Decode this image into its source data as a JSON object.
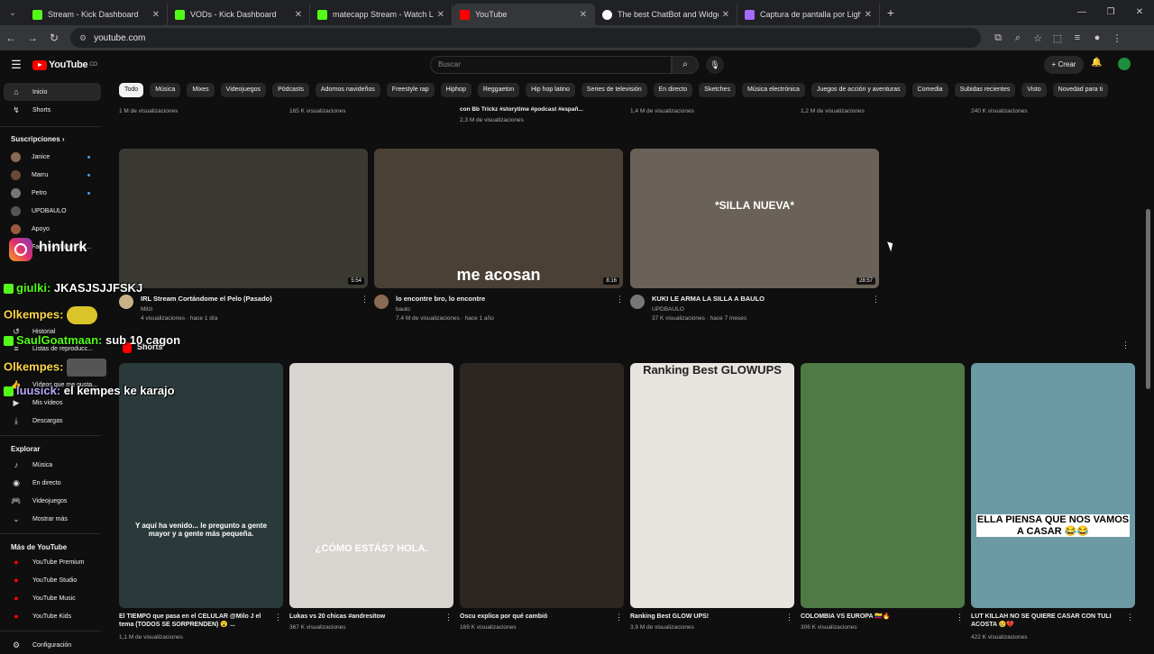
{
  "browser": {
    "tabs": [
      {
        "label": "Stream - Kick Dashboard",
        "color": "#53fc18"
      },
      {
        "label": "VODs - Kick Dashboard",
        "color": "#53fc18"
      },
      {
        "label": "matecapp Stream - Watch Live",
        "color": "#53fc18"
      },
      {
        "label": "YouTube",
        "color": "#ff0000"
      },
      {
        "label": "The best ChatBot and Widgets",
        "color": "#ffffff"
      },
      {
        "label": "Captura de pantalla por Lightshot",
        "color": "#a56bff"
      }
    ],
    "active_tab": 3,
    "url": "youtube.com"
  },
  "header": {
    "search_placeholder": "Buscar",
    "create_label": "Crear"
  },
  "chips": [
    "Todo",
    "Música",
    "Mixes",
    "Videojuegos",
    "Pódcasts",
    "Adornos navideños",
    "Freestyle rap",
    "Hiphop",
    "Reggaeton",
    "Hip hop latino",
    "Series de televisión",
    "En directo",
    "Sketches",
    "Música electrónica",
    "Juegos de acción y aventuras",
    "Comedia",
    "Subidas recientes",
    "Visto",
    "Novedad para ti"
  ],
  "sidebar": {
    "inicio": "Inicio",
    "shorts": "Shorts",
    "subs_title": "Suscripciones",
    "subs": [
      {
        "name": "Janice",
        "color": "#8a6a55"
      },
      {
        "name": "Marru",
        "color": "#6b4a3a"
      },
      {
        "name": "Petro",
        "color": "#777777"
      },
      {
        "name": "UPDBAULO",
        "color": "#555555"
      },
      {
        "name": "Apoyo",
        "color": "#995a3c"
      },
      {
        "name": "Fans Del JugueTon...",
        "color": "#444444"
      }
    ],
    "mostrar_mas_partial": "Mostrar más",
    "historial": "Historial",
    "listas": "Listas de reproducc...",
    "tus_videos": "Vídeos que me gusta...",
    "mis_videos": "Mis vídeos",
    "descargas": "Descargas",
    "explorar_title": "Explorar",
    "explorar": [
      "Música",
      "En directo",
      "Videojuegos",
      "Mostrar más"
    ],
    "mas_title": "Más de YouTube",
    "mas": [
      "YouTube Premium",
      "YouTube Studio",
      "YouTube Music",
      "YouTube Kids"
    ],
    "config": "Configuración"
  },
  "top_row": [
    "1 M de visualizaciones",
    "165 K visualizaciones",
    "con Bb Trickz #storytime #podcast #españ...",
    "2,3 M de visualizaciones",
    "1,4 M de visualizaciones",
    "1,2 M de visualizaciones",
    "240 K visualizaciones"
  ],
  "videos": [
    {
      "title": "IRL Stream Cortándome el Pelo (Pasado)",
      "channel": "Mitzi",
      "meta": "4 visualizaciones · hace 1 día",
      "duration": "5:54",
      "color": "#3b3a32",
      "avatar": "#c9b28a"
    },
    {
      "title": "lo encontre bro, lo encontre",
      "channel": "baulo",
      "meta": "7,4 M de visualizaciones · hace 1 año",
      "duration": "8:16",
      "color": "#4a4036",
      "avatar": "#8a6a55",
      "caption": "me acosan"
    },
    {
      "title": "KUKI LE ARMA LA SILLA A BAULO",
      "channel": "UPDBAULO",
      "meta": "37 K visualizaciones · hace 7 meses",
      "duration": "28:57",
      "color": "#6a6258",
      "avatar": "#777777",
      "caption": "*SILLA NUEVA*"
    }
  ],
  "shorts_title": "Shorts",
  "shorts": [
    {
      "title": "El TIEMPO que pasa en el CELULAR @Milo J el tema (TODOS SE SORPRENDEN) 😮 ...",
      "meta": "1,1 M de visualizaciones",
      "color": "#2a3a3a",
      "caption": "Y aquí ha venido... le pregunto a gente mayor y a gente más pequeña."
    },
    {
      "title": "Lukas vs 20 chicas #andresitow",
      "meta": "367 K visualizaciones",
      "color": "#d8d5d0",
      "caption": "¿CÓMO ESTÁS? HOLA."
    },
    {
      "title": "Oscu explica por qué cambió",
      "meta": "169 K visualizaciones",
      "color": "#2b2622",
      "caption": ""
    },
    {
      "title": "Ranking Best GLOW UPS!",
      "meta": "3,9 M de visualizaciones",
      "color": "#e7e4df",
      "caption": "Ranking Best GLOWUPS"
    },
    {
      "title": "COLOMBIA VS EUROPA 🇨🇴🔥",
      "meta": "306 K visualizaciones",
      "color": "#4f7a45",
      "caption": ""
    },
    {
      "title": "LUT KILLAH NO SE QUIERE CASAR CON TULI ACOSTA 😢💔",
      "meta": "422 K visualizaciones",
      "color": "#6b9aa5",
      "caption": "ELLA PIENSA QUE NOS VAMOS A CASAR 😂😂"
    }
  ],
  "overlay": {
    "ig_name": "hinlurk",
    "chat": [
      {
        "user": "giulki:",
        "msg": "JKASJSJJFSKJ"
      },
      {
        "user": "Olkempes:",
        "msg": ""
      },
      {
        "user": "SaulGoatmaan:",
        "msg": "sub 10 cagon"
      },
      {
        "user": "Olkempes:",
        "msg": ""
      },
      {
        "user": "luusick:",
        "msg": "el kempes ke karajo"
      }
    ]
  }
}
